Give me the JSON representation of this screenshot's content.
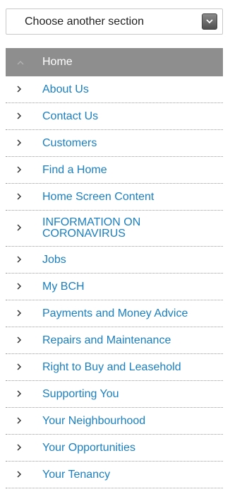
{
  "section_select": {
    "value": "Choose another section",
    "arrow_icon": "chevron-down-icon"
  },
  "menu": {
    "items": [
      {
        "label": "Home",
        "active": true,
        "icon": "chevron-up-icon"
      },
      {
        "label": "About Us",
        "icon": "chevron-right-icon"
      },
      {
        "label": "Contact Us",
        "icon": "chevron-right-icon"
      },
      {
        "label": "Customers",
        "icon": "chevron-right-icon"
      },
      {
        "label": "Find a Home",
        "icon": "chevron-right-icon"
      },
      {
        "label": "Home Screen Content",
        "icon": "chevron-right-icon"
      },
      {
        "label": "INFORMATION ON CORONAVIRUS",
        "icon": "chevron-right-icon"
      },
      {
        "label": "Jobs",
        "icon": "chevron-right-icon"
      },
      {
        "label": "My BCH",
        "icon": "chevron-right-icon"
      },
      {
        "label": "Payments and Money Advice",
        "icon": "chevron-right-icon"
      },
      {
        "label": "Repairs and Maintenance",
        "icon": "chevron-right-icon"
      },
      {
        "label": "Right to Buy and Leasehold",
        "icon": "chevron-right-icon"
      },
      {
        "label": "Supporting You",
        "icon": "chevron-right-icon"
      },
      {
        "label": "Your Neighbourhood",
        "icon": "chevron-right-icon"
      },
      {
        "label": "Your Opportunities",
        "icon": "chevron-right-icon"
      },
      {
        "label": "Your Tenancy",
        "icon": "chevron-right-icon"
      }
    ]
  },
  "colors": {
    "link": "#1a7fc1",
    "active_bg": "#8e8e8e",
    "active_text": "#ffffff"
  }
}
